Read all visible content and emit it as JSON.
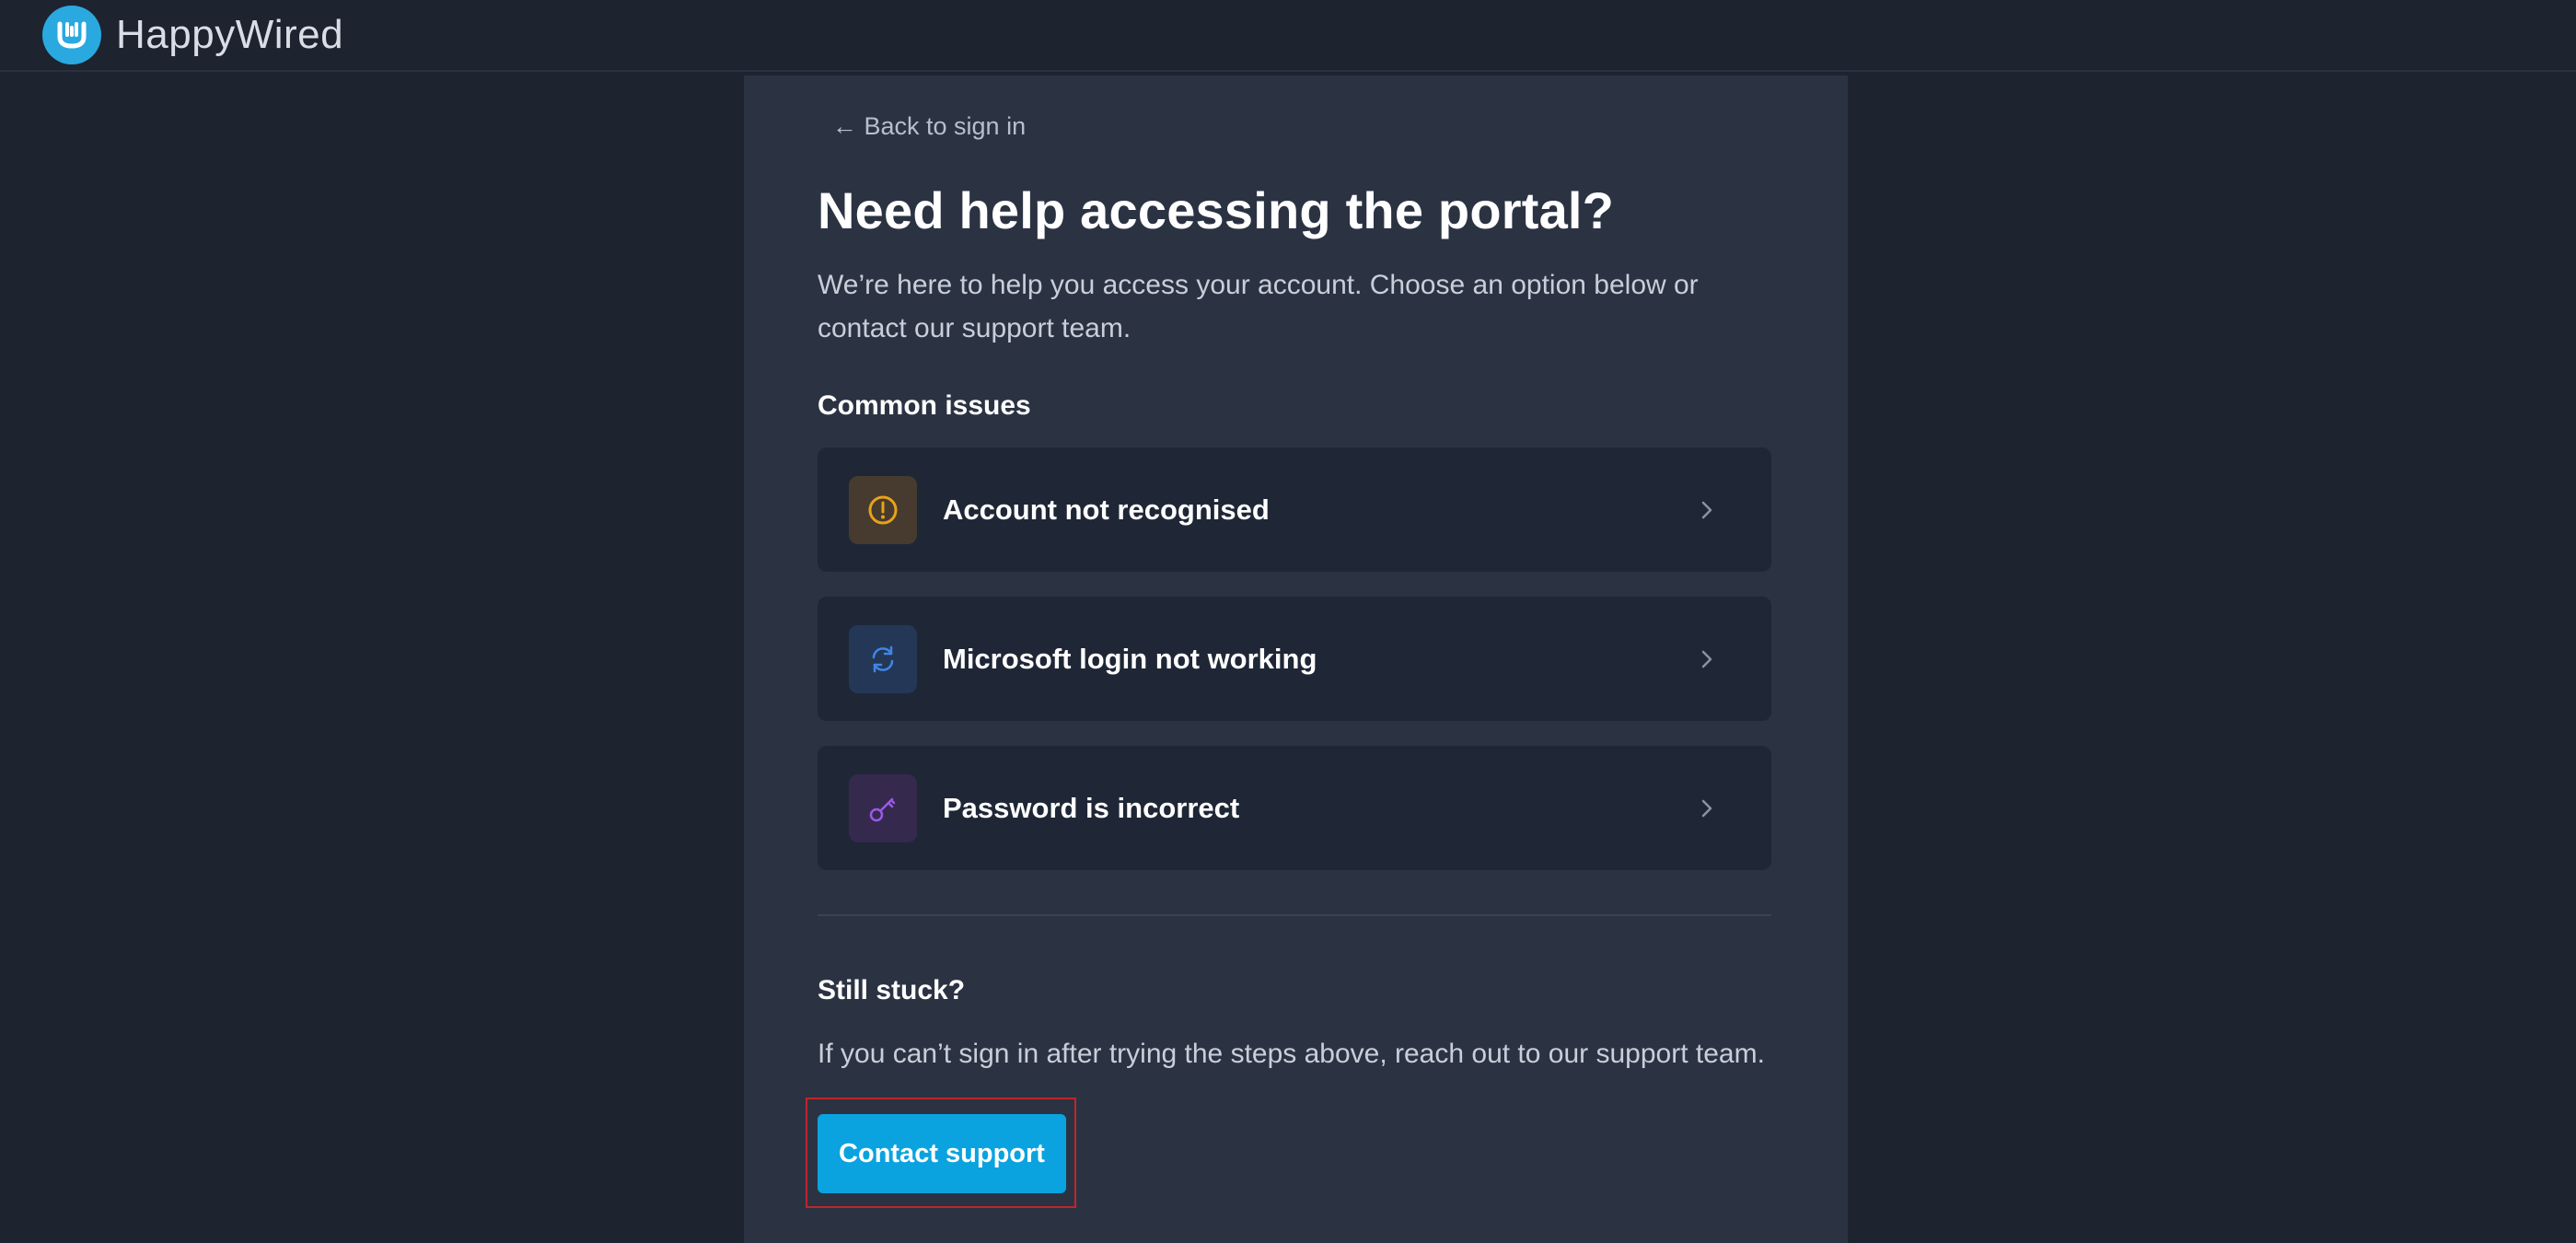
{
  "app": {
    "brand_name": "HappyWired",
    "logo_icon": "happywired-logo-icon",
    "colors": {
      "background": "#1e2330",
      "panel": "#2b3343",
      "card": "#1f2736",
      "accent": "#0aa3e0",
      "highlight_outline": "#c0252b"
    }
  },
  "page": {
    "back_link": "← Back to sign in",
    "title": "Need help accessing the portal?",
    "intro": "We’re here to help you access your account. Choose an option below or contact our support team."
  },
  "common_issues": {
    "heading": "Common issues",
    "items": [
      {
        "label": "Account not recognised",
        "icon": "alert-circle-icon",
        "icon_color": "#e8a21a",
        "icon_bg": "#463b2e"
      },
      {
        "label": "Microsoft login not working",
        "icon": "refresh-icon",
        "icon_color": "#3f86e8",
        "icon_bg": "#243756"
      },
      {
        "label": "Password is incorrect",
        "icon": "key-icon",
        "icon_color": "#9b59e6",
        "icon_bg": "#35294d"
      }
    ]
  },
  "still_stuck": {
    "heading": "Still stuck?",
    "text": "If you can’t sign in after trying the steps above, reach out to our support team.",
    "button_label": "Contact support"
  }
}
